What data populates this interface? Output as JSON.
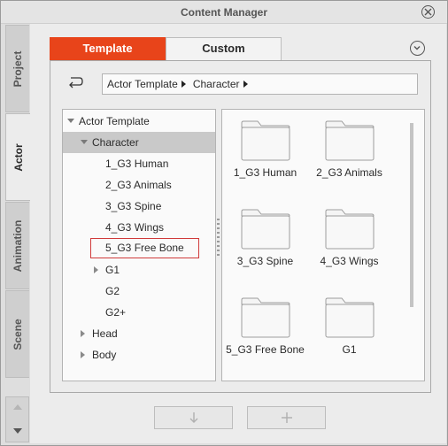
{
  "window": {
    "title": "Content Manager"
  },
  "side_tabs": [
    {
      "label": "Project"
    },
    {
      "label": "Actor"
    },
    {
      "label": "Animation"
    },
    {
      "label": "Scene"
    }
  ],
  "top_tabs": {
    "template": "Template",
    "custom": "Custom"
  },
  "breadcrumb": [
    "Actor Template",
    "Character"
  ],
  "tree": {
    "root": "Actor Template",
    "character": "Character",
    "children": [
      "1_G3 Human",
      "2_G3 Animals",
      "3_G3 Spine",
      "4_G3 Wings",
      "5_G3 Free Bone",
      "G1",
      "G2",
      "G2+"
    ],
    "head": "Head",
    "body": "Body"
  },
  "folders": [
    "1_G3 Human",
    "2_G3 Animals",
    "3_G3 Spine",
    "4_G3 Wings",
    "5_G3 Free Bone",
    "G1"
  ],
  "colors": {
    "accent": "#e8441a",
    "selection_outline": "#d03a3a"
  },
  "icons": {
    "close": "close-icon",
    "collapse": "chevron-down-icon",
    "back": "return-icon",
    "download": "arrow-down-icon",
    "add": "plus-icon",
    "folder": "folder-icon"
  }
}
